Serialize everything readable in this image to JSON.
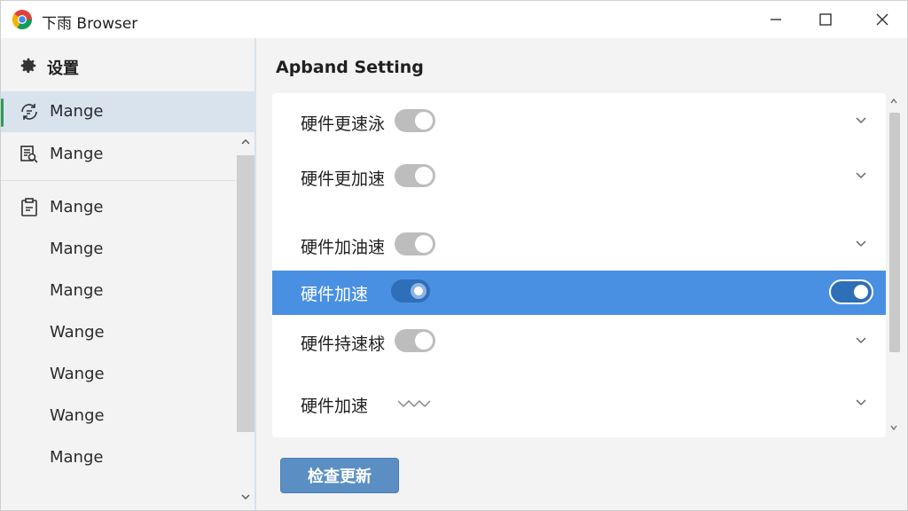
{
  "window": {
    "title": "下雨 Browser"
  },
  "sidebar": {
    "header_label": "设置",
    "items": [
      {
        "label": "Mange",
        "icon": "sync-icon",
        "active": true
      },
      {
        "label": "Mange",
        "icon": "find-document-icon",
        "active": false
      },
      {
        "label": "Mange",
        "icon": "clipboard-icon",
        "active": false
      },
      {
        "label": "Mange",
        "icon": "",
        "active": false
      },
      {
        "label": "Mange",
        "icon": "",
        "active": false
      },
      {
        "label": "Wange",
        "icon": "",
        "active": false
      },
      {
        "label": "Wange",
        "icon": "",
        "active": false
      },
      {
        "label": "Wange",
        "icon": "",
        "active": false
      },
      {
        "label": "Mange",
        "icon": "",
        "active": false
      }
    ]
  },
  "main": {
    "title": "Apband Setting",
    "rows": [
      {
        "label": "硬件更速泳",
        "toggle": "off"
      },
      {
        "label": "硬件更加速",
        "toggle": "off"
      },
      {
        "label": "硬件加油速",
        "toggle": "off"
      },
      {
        "label": "硬件加速",
        "toggle": "on",
        "selected": true
      },
      {
        "label": "硬件持速梂",
        "toggle": "off"
      },
      {
        "label": "硬件加速",
        "toggle": "wave"
      }
    ],
    "check_button_label": "检查更新"
  },
  "colors": {
    "accent_blue": "#4a90e2",
    "active_bar_green": "#2e9a57",
    "button_blue": "#5b8fc4"
  }
}
